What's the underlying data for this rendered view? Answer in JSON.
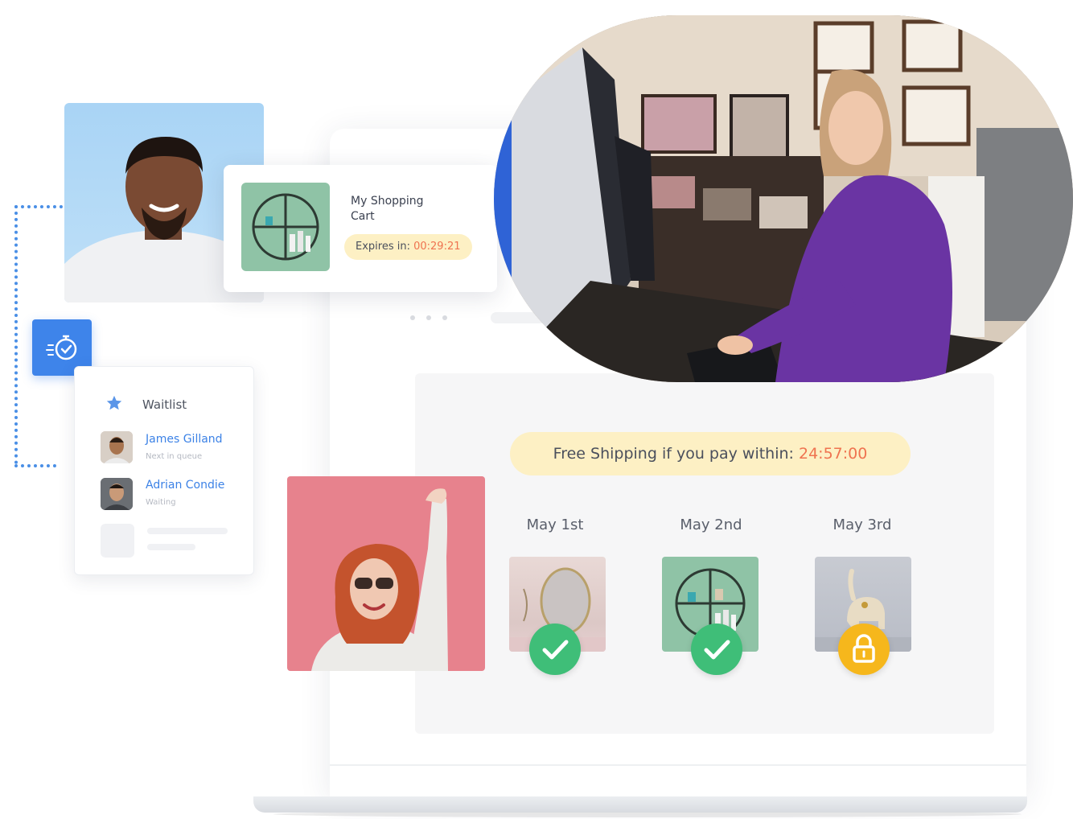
{
  "cart": {
    "title": "My Shopping Cart",
    "expires_label": "Expires in:",
    "expires_time": "00:29:21"
  },
  "waitlist": {
    "title": "Waitlist",
    "entries": [
      {
        "name": "James Gilland",
        "status": "Next in queue"
      },
      {
        "name": "Adrian Condie",
        "status": "Waiting"
      }
    ]
  },
  "shipping": {
    "label": "Free Shipping if you pay within:",
    "time": "24:57:00"
  },
  "schedule": [
    {
      "day": "May 1st",
      "product": "round mirror",
      "state": "unlocked",
      "icon": "check-icon"
    },
    {
      "day": "May 2nd",
      "product": "round shelf",
      "state": "unlocked",
      "icon": "check-icon"
    },
    {
      "day": "May 3rd",
      "product": "elephant figurine",
      "state": "locked",
      "icon": "lock-icon"
    }
  ],
  "colors": {
    "accent_blue": "#3e84ea",
    "highlight_red": "#ef7350",
    "pill_yellow": "#fdf0c4",
    "check_green": "#3fbe78",
    "lock_yellow": "#f6b71c",
    "pink_card": "#e7828d",
    "sky_card": "#a9d4f5"
  }
}
